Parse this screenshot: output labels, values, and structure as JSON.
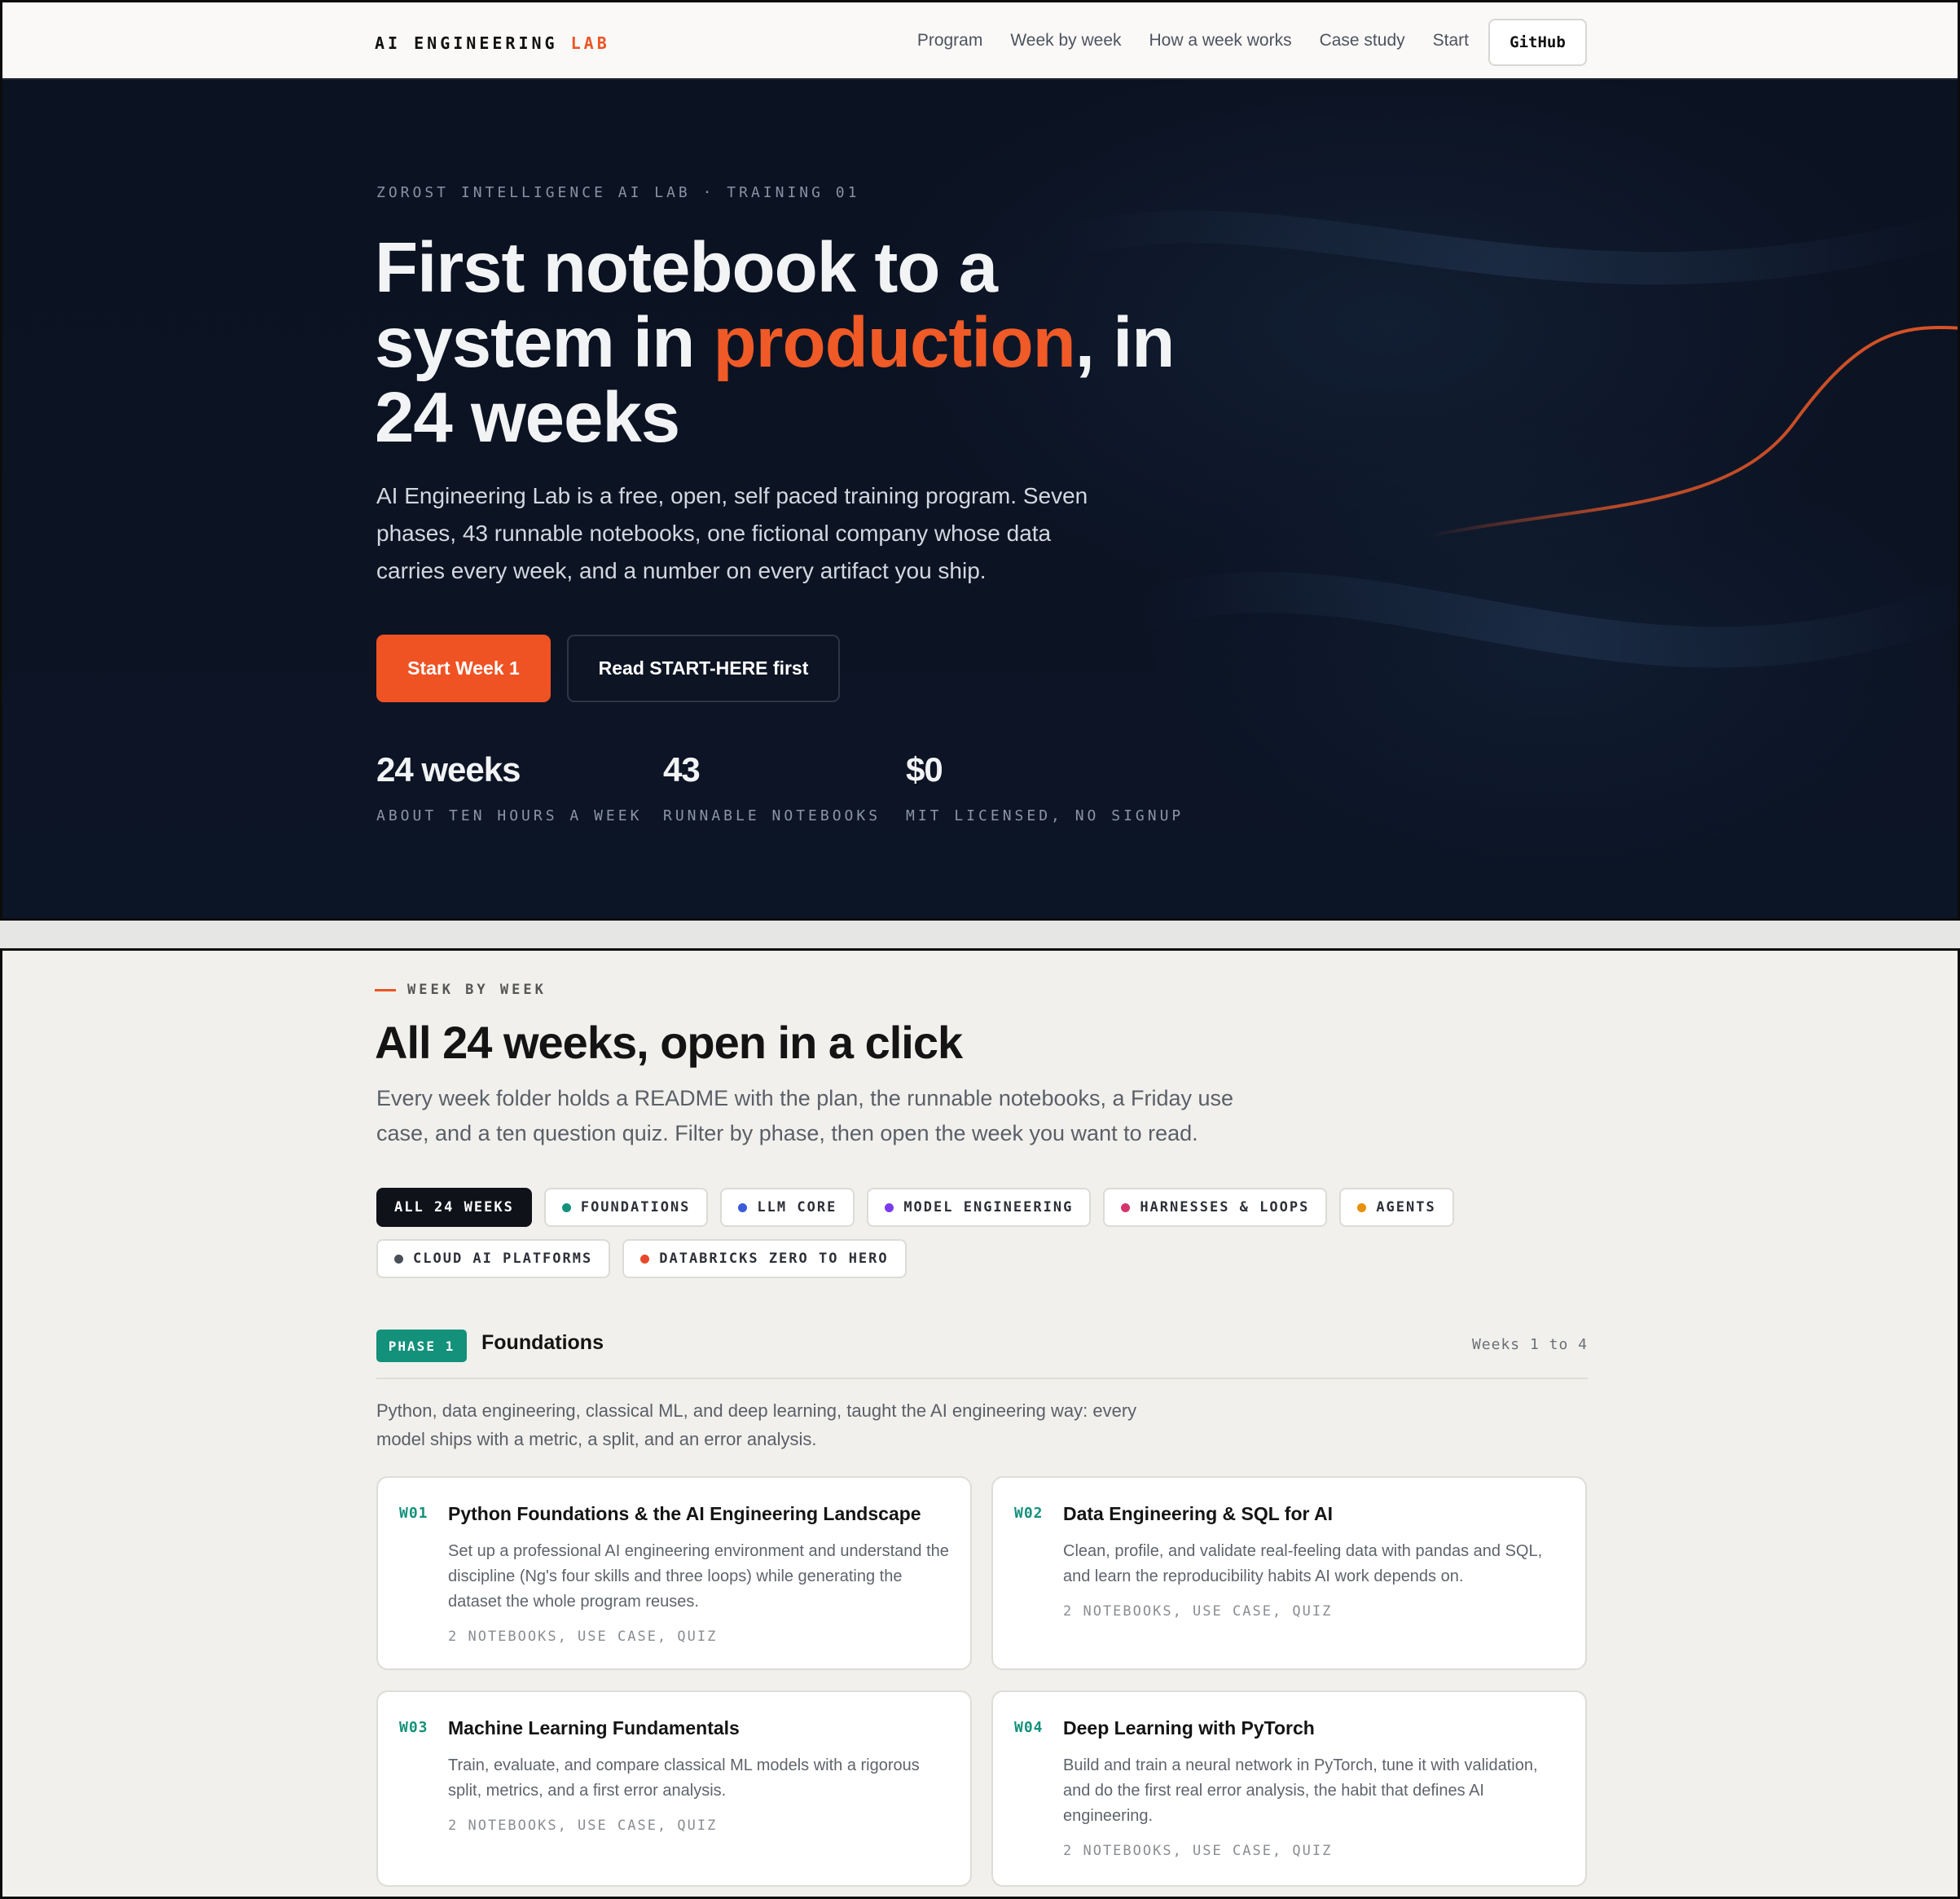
{
  "nav": {
    "brand_main": "AI ENGINEERING",
    "brand_accent": "LAB",
    "links": [
      "Program",
      "Week by week",
      "How a week works",
      "Case study",
      "Start"
    ],
    "github_label": "GitHub"
  },
  "hero": {
    "eyebrow": "ZOROST INTELLIGENCE AI LAB · TRAINING 01",
    "title_part1": "First notebook to a system in ",
    "title_highlight": "production",
    "title_part2": ", in 24 weeks",
    "subtitle": "AI Engineering Lab is a free, open, self paced training program. Seven phases, 43 runnable notebooks, one fictional company whose data carries every week, and a number on every artifact you ship.",
    "primary_button": "Start Week 1",
    "secondary_button": "Read START-HERE first",
    "stats": [
      {
        "value": "24 weeks",
        "label": "ABOUT TEN HOURS A WEEK"
      },
      {
        "value": "43",
        "label": "RUNNABLE NOTEBOOKS"
      },
      {
        "value": "$0",
        "label": "MIT LICENSED, NO SIGNUP"
      }
    ],
    "accent_color": "#f05a26",
    "background_color": "#0b1220"
  },
  "weeks_section": {
    "eyebrow": "WEEK BY WEEK",
    "title": "All 24 weeks, open in a click",
    "subtitle": "Every week folder holds a README with the plan, the runnable notebooks, a Friday use case, and a ten question quiz. Filter by phase, then open the week you want to read.",
    "filters": [
      {
        "label": "ALL 24 WEEKS",
        "color": "",
        "active": true
      },
      {
        "label": "FOUNDATIONS",
        "color": "#14917b",
        "active": false
      },
      {
        "label": "LLM CORE",
        "color": "#3b5bdb",
        "active": false
      },
      {
        "label": "MODEL ENGINEERING",
        "color": "#7c3aed",
        "active": false
      },
      {
        "label": "HARNESSES & LOOPS",
        "color": "#d6336c",
        "active": false
      },
      {
        "label": "AGENTS",
        "color": "#e8900c",
        "active": false
      },
      {
        "label": "CLOUD AI PLATFORMS",
        "color": "#495057",
        "active": false
      },
      {
        "label": "DATABRICKS ZERO TO HERO",
        "color": "#e8492a",
        "active": false
      }
    ],
    "phase": {
      "badge": "PHASE 1",
      "name": "Foundations",
      "range": "Weeks 1 to 4",
      "description": "Python, data engineering, classical ML, and deep learning, taught the AI engineering way: every model ships with a metric, a split, and an error analysis."
    },
    "weeks": [
      {
        "code": "W01",
        "title": "Python Foundations & the AI Engineering Landscape",
        "desc": "Set up a professional AI engineering environment and understand the discipline (Ng's four skills and three loops) while generating the dataset the whole program reuses.",
        "meta": "2 NOTEBOOKS, USE CASE, QUIZ"
      },
      {
        "code": "W02",
        "title": "Data Engineering & SQL for AI",
        "desc": "Clean, profile, and validate real-feeling data with pandas and SQL, and learn the reproducibility habits AI work depends on.",
        "meta": "2 NOTEBOOKS, USE CASE, QUIZ"
      },
      {
        "code": "W03",
        "title": "Machine Learning Fundamentals",
        "desc": "Train, evaluate, and compare classical ML models with a rigorous split, metrics, and a first error analysis.",
        "meta": "2 NOTEBOOKS, USE CASE, QUIZ"
      },
      {
        "code": "W04",
        "title": "Deep Learning with PyTorch",
        "desc": "Build and train a neural network in PyTorch, tune it with validation, and do the first real error analysis, the habit that defines AI engineering.",
        "meta": "2 NOTEBOOKS, USE CASE, QUIZ"
      }
    ]
  }
}
